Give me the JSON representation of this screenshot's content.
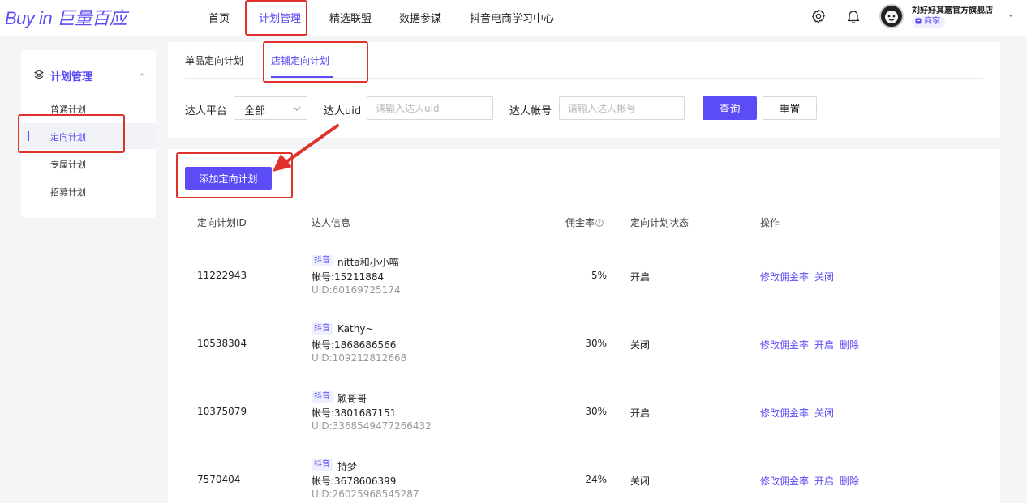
{
  "logo": {
    "buyin": "Buy in",
    "brand_cn": "巨量百应"
  },
  "nav": {
    "items": [
      {
        "label": "首页"
      },
      {
        "label": "计划管理"
      },
      {
        "label": "精选联盟"
      },
      {
        "label": "数据参谋"
      },
      {
        "label": "抖音电商学习中心"
      }
    ],
    "active_index": 1
  },
  "user": {
    "shop_name": "刘好好其嘉官方旗舰店",
    "role_badge": "商家"
  },
  "sidebar": {
    "section_title": "计划管理",
    "items": [
      {
        "label": "普通计划"
      },
      {
        "label": "定向计划"
      },
      {
        "label": "专属计划"
      },
      {
        "label": "招募计划"
      }
    ],
    "active_index": 1
  },
  "subtabs": {
    "items": [
      {
        "label": "单品定向计划"
      },
      {
        "label": "店铺定向计划"
      }
    ],
    "active_index": 1
  },
  "filters": {
    "platform_label": "达人平台",
    "platform_value": "全部",
    "uid_label": "达人uid",
    "uid_placeholder": "请输入达人uid",
    "account_label": "达人帐号",
    "account_placeholder": "请输入达人帐号",
    "query_button": "查询",
    "reset_button": "重置"
  },
  "add_button": "添加定向计划",
  "table": {
    "headers": {
      "id": "定向计划ID",
      "info": "达人信息",
      "rate": "佣金率",
      "status": "定向计划状态",
      "actions": "操作"
    },
    "rows": [
      {
        "id": "11222943",
        "platform": "抖音",
        "name": "nitta和小小喵",
        "account": "帐号:15211884",
        "uid": "UID:60169725174",
        "rate": "5%",
        "status": "开启",
        "actions": [
          "修改佣金率",
          "关闭"
        ]
      },
      {
        "id": "10538304",
        "platform": "抖音",
        "name": "Kathy~",
        "account": "帐号:1868686566",
        "uid": "UID:109212812668",
        "rate": "30%",
        "status": "关闭",
        "actions": [
          "修改佣金率",
          "开启",
          "删除"
        ]
      },
      {
        "id": "10375079",
        "platform": "抖音",
        "name": "颖哥哥",
        "account": "帐号:3801687151",
        "uid": "UID:3368549477266432",
        "rate": "30%",
        "status": "开启",
        "actions": [
          "修改佣金率",
          "关闭"
        ]
      },
      {
        "id": "7570404",
        "platform": "抖音",
        "name": "持梦",
        "account": "帐号:3678606399",
        "uid": "UID:26025968545287",
        "rate": "24%",
        "status": "关闭",
        "actions": [
          "修改佣金率",
          "开启",
          "删除"
        ]
      }
    ]
  },
  "colors": {
    "accent": "#5b4cf5",
    "highlight_red": "#e0312b"
  }
}
